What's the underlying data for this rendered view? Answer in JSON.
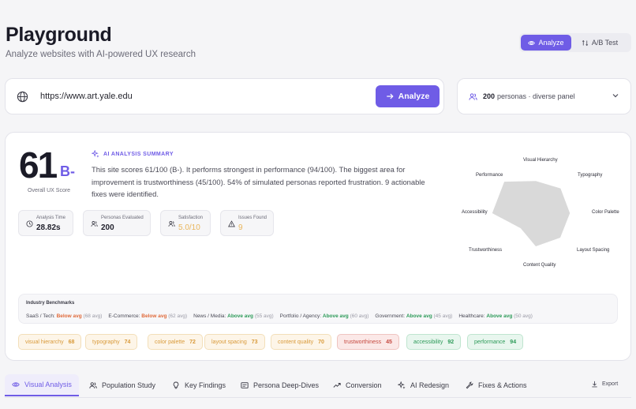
{
  "header": {
    "title": "Playground",
    "subtitle": "Analyze websites with AI-powered UX research",
    "modes": [
      {
        "label": "Analyze",
        "icon": "eye-icon",
        "active": true
      },
      {
        "label": "A/B Test",
        "icon": "swap-icon",
        "active": false
      }
    ]
  },
  "url_input": {
    "value": "https://www.art.yale.edu",
    "button_label": "Analyze"
  },
  "persona_select": {
    "count": "200",
    "label": "personas · diverse panel"
  },
  "score": {
    "value": "61",
    "grade": "B-",
    "label": "Overall UX Score"
  },
  "ai_summary": {
    "label": "AI ANALYSIS SUMMARY",
    "text": "This site scores 61/100 (B-). It performs strongest in performance (94/100). The biggest area for improvement is trustworthiness (45/100). 54% of simulated personas reported frustration. 9 actionable fixes were identified."
  },
  "stats": [
    {
      "label": "Analysis Time",
      "value": "28.82s",
      "icon": "clock-icon"
    },
    {
      "label": "Personas Evaluated",
      "value": "200",
      "icon": "users-icon"
    },
    {
      "label": "Satisfaction",
      "value": "5.0/10",
      "icon": "users-icon"
    },
    {
      "label": "Issues Found",
      "value": "9",
      "icon": "warning-icon"
    }
  ],
  "radar": {
    "labels": [
      "Visual Hierarchy",
      "Typography",
      "Color Palette",
      "Layout Spacing",
      "Content Quality",
      "Trustworthiness",
      "Accessibility",
      "Performance"
    ],
    "values": [
      68,
      74,
      72,
      73,
      70,
      45,
      92,
      94
    ],
    "fill_color": "#d9d9d9"
  },
  "benchmarks": {
    "title": "Industry Benchmarks",
    "items": [
      {
        "name": "SaaS / Tech:",
        "status": "Below avg",
        "avg": "(68 avg)",
        "tone": "below"
      },
      {
        "name": "E-Commerce:",
        "status": "Below avg",
        "avg": "(62 avg)",
        "tone": "below"
      },
      {
        "name": "News / Media:",
        "status": "Above avg",
        "avg": "(55 avg)",
        "tone": "above"
      },
      {
        "name": "Portfolio / Agency:",
        "status": "Above avg",
        "avg": "(60 avg)",
        "tone": "above"
      },
      {
        "name": "Government:",
        "status": "Above avg",
        "avg": "(45 avg)",
        "tone": "above"
      },
      {
        "name": "Healthcare:",
        "status": "Above avg",
        "avg": "(50 avg)",
        "tone": "above"
      }
    ]
  },
  "chips": [
    {
      "label": "visual hierarchy",
      "value": "68",
      "tone": "amber"
    },
    {
      "label": "typography",
      "value": "74",
      "tone": "amber"
    },
    {
      "label": "color palette",
      "value": "72",
      "tone": "amber"
    },
    {
      "label": "layout spacing",
      "value": "73",
      "tone": "amber"
    },
    {
      "label": "content quality",
      "value": "70",
      "tone": "amber"
    },
    {
      "label": "trustworthiness",
      "value": "45",
      "tone": "red"
    },
    {
      "label": "accessibility",
      "value": "92",
      "tone": "green"
    },
    {
      "label": "performance",
      "value": "94",
      "tone": "green"
    }
  ],
  "tabs": [
    {
      "label": "Visual Analysis",
      "icon": "eye-icon",
      "active": true
    },
    {
      "label": "Population Study",
      "icon": "users-icon"
    },
    {
      "label": "Key Findings",
      "icon": "lightbulb-icon"
    },
    {
      "label": "Persona Deep-Dives",
      "icon": "card-icon"
    },
    {
      "label": "Conversion",
      "icon": "trend-icon"
    },
    {
      "label": "AI Redesign",
      "icon": "sparkle-icon"
    },
    {
      "label": "Fixes & Actions",
      "icon": "wrench-icon"
    }
  ],
  "export_label": "Export",
  "colors": {
    "accent": "#6f5ce6",
    "below": "#e06a3a",
    "above": "#2c9a58",
    "amber": "#e9b65c"
  }
}
